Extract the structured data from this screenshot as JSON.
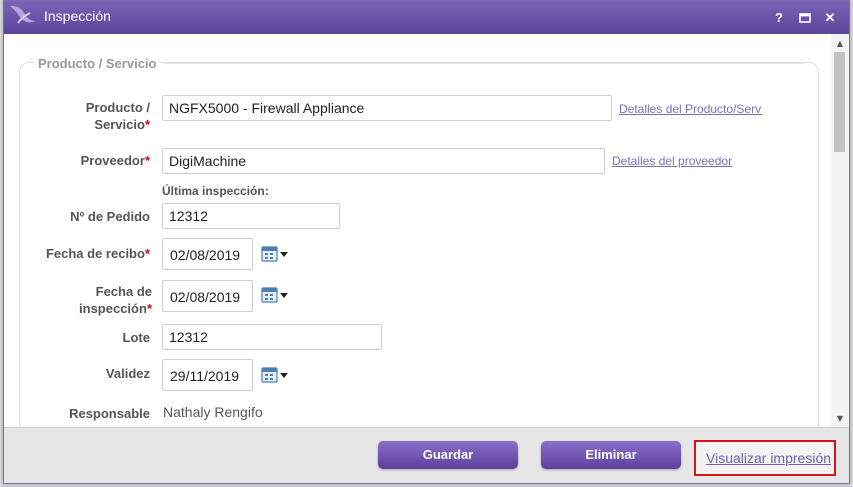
{
  "window": {
    "title": "Inspección",
    "help_label": "?",
    "maximize_label": "▭",
    "close_label": "✕"
  },
  "section": {
    "legend": "Producto / Servicio"
  },
  "form": {
    "producto": {
      "label_line1": "Producto /",
      "label_line2": "Servicio",
      "required_mark": "*",
      "value": "NGFX5000 - Firewall Appliance",
      "link": "Detalles del Producto/Servi"
    },
    "proveedor": {
      "label": "Proveedor",
      "required_mark": "*",
      "value": "DigiMachine",
      "link": "Detalles del proveedor"
    },
    "ultima_inspeccion": {
      "label": "Última inspección:"
    },
    "pedido": {
      "label": "Nº de Pedido",
      "value": "12312"
    },
    "fecha_recibo": {
      "label": "Fecha de recibo",
      "required_mark": "*",
      "value": "02/08/2019"
    },
    "fecha_inspeccion": {
      "label_line1": "Fecha de",
      "label_line2": "inspección",
      "required_mark": "*",
      "value": "02/08/2019"
    },
    "lote": {
      "label": "Lote",
      "value": "12312"
    },
    "validez": {
      "label": "Validez",
      "value": "29/11/2019"
    },
    "responsable": {
      "label": "Responsable",
      "value": "Nathaly Rengifo"
    }
  },
  "footer": {
    "save_label": "Guardar",
    "delete_label": "Eliminar",
    "print_label": "Visualizar impresión"
  },
  "colors": {
    "titlebar": "#5b4499",
    "button": "#6a4bb0",
    "required": "#d0021b",
    "highlight_border": "#d6141b",
    "link": "#7a6fb8"
  }
}
